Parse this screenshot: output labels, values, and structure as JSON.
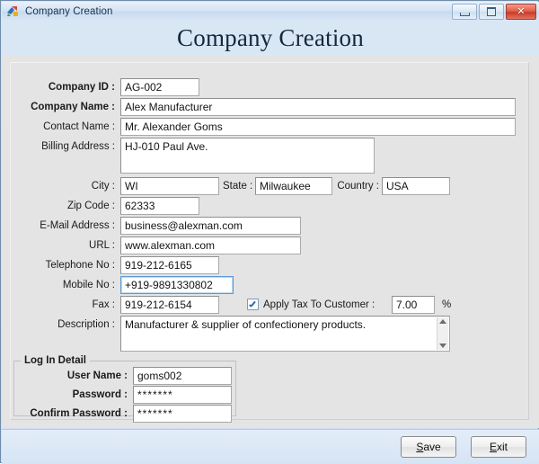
{
  "window": {
    "title": "Company Creation",
    "icon": "app-icon",
    "controls": {
      "minimize": "minimize",
      "maximize": "maximize",
      "close": "close"
    }
  },
  "header": {
    "title": "Company Creation"
  },
  "form": {
    "fields": [
      {
        "label": "Company ID :",
        "value": "AG-002",
        "bold": true
      },
      {
        "label": "Company Name :",
        "value": "Alex Manufacturer",
        "bold": true
      },
      {
        "label": "Contact Name :",
        "value": "Mr. Alexander Goms",
        "bold": false
      },
      {
        "label": "Billing Address :",
        "value": "HJ-010 Paul Ave.",
        "bold": false
      },
      {
        "label": "City :",
        "value": "WI",
        "bold": false
      },
      {
        "label": "State :",
        "value": "Milwaukee",
        "bold": false
      },
      {
        "label": "Country :",
        "value": "USA",
        "bold": false
      },
      {
        "label": "Zip Code :",
        "value": "62333",
        "bold": false
      },
      {
        "label": "E-Mail Address :",
        "value": "business@alexman.com",
        "bold": false
      },
      {
        "label": "URL :",
        "value": "www.alexman.com",
        "bold": false
      },
      {
        "label": "Telephone No :",
        "value": "919-212-6165",
        "bold": false
      },
      {
        "label": "Mobile No :",
        "value": "+919-9891330802",
        "bold": false
      },
      {
        "label": "Fax :",
        "value": "919-212-6154",
        "bold": false
      },
      {
        "label": "Description :",
        "value": "Manufacturer & supplier of confectionery products.",
        "bold": false
      }
    ],
    "tax": {
      "checkbox_label": "Apply Tax To Customer :",
      "checked": true,
      "value": "7.00",
      "unit": "%"
    }
  },
  "login": {
    "group_title": "Log In Detail",
    "fields": [
      {
        "label": "User Name :",
        "value": "goms002"
      },
      {
        "label": "Password :",
        "value": "*******"
      },
      {
        "label": "Confirm Password :",
        "value": "*******"
      }
    ]
  },
  "footer": {
    "save": {
      "pre": "",
      "accel": "S",
      "post": "ave"
    },
    "exit": {
      "pre": "",
      "accel": "E",
      "post": "xit"
    }
  },
  "colors": {
    "titlebar": "#d4e3f3",
    "header_band": "#d9e7f5",
    "body": "#e4e4e4",
    "close_button": "#c93c26",
    "focus_border": "#5b9ad4"
  }
}
